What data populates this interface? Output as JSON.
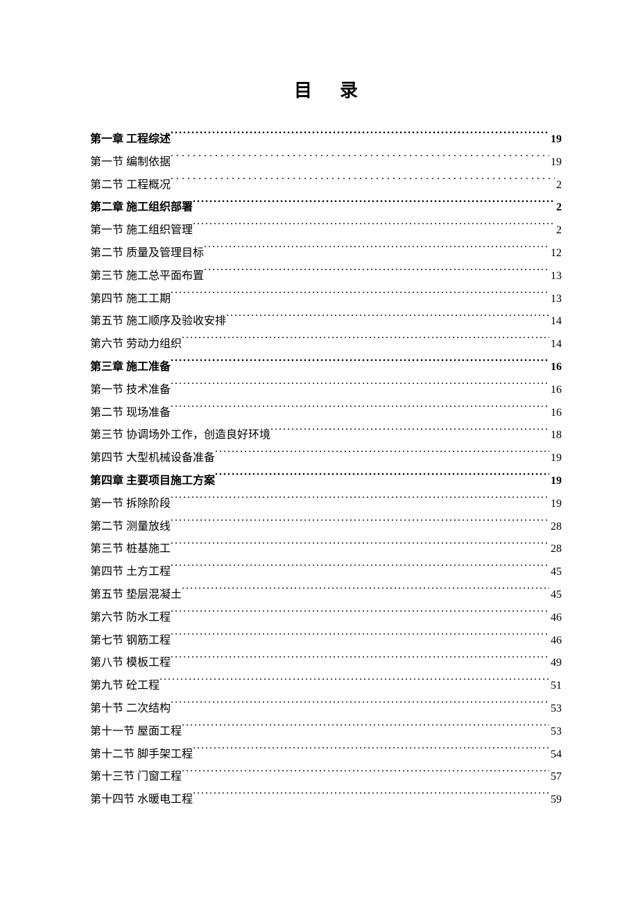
{
  "title": "目录",
  "toc": [
    {
      "label": "第一章 工程综述 ",
      "page": "19",
      "bold": true,
      "leader": "dense"
    },
    {
      "label": "第一节 编制依据 ",
      "page": " 19",
      "bold": false,
      "leader": "sparse"
    },
    {
      "label": "第二节 工程概况 ",
      "page": " 2",
      "bold": false,
      "leader": "sparse"
    },
    {
      "label": "第二章 施工组织部署 ",
      "page": "2",
      "bold": true,
      "leader": "dense"
    },
    {
      "label": "第一节 施工组织管理",
      "page": "2",
      "bold": false,
      "leader": "dense"
    },
    {
      "label": "第二节 质量及管理目标",
      "page": "12",
      "bold": false,
      "leader": "dense"
    },
    {
      "label": "第三节 施工总平面布置",
      "page": "13",
      "bold": false,
      "leader": "dense"
    },
    {
      "label": "第四节 施工工期",
      "page": "13",
      "bold": false,
      "leader": "dense"
    },
    {
      "label": "第五节 施工顺序及验收安排",
      "page": "14",
      "bold": false,
      "leader": "dense"
    },
    {
      "label": "第六节 劳动力组织",
      "page": "14",
      "bold": false,
      "leader": "dense"
    },
    {
      "label": "第三章 施工准备 ",
      "page": "16",
      "bold": true,
      "leader": "dense"
    },
    {
      "label": "第一节 技术准备",
      "page": "16",
      "bold": false,
      "leader": "dense"
    },
    {
      "label": "第二节 现场准备",
      "page": "16",
      "bold": false,
      "leader": "dense"
    },
    {
      "label": "第三节 协调场外工作，创造良好环境",
      "page": "18",
      "bold": false,
      "leader": "dense"
    },
    {
      "label": "第四节 大型机械设备准备",
      "page": "19",
      "bold": false,
      "leader": "dense"
    },
    {
      "label": "第四章 主要项目施工方案 ",
      "page": "19",
      "bold": true,
      "leader": "dense"
    },
    {
      "label": "第一节 拆除阶段",
      "page": "19",
      "bold": false,
      "leader": "dense"
    },
    {
      "label": "第二节 测量放线",
      "page": "28",
      "bold": false,
      "leader": "dense"
    },
    {
      "label": "第三节 桩基施工",
      "page": "28",
      "bold": false,
      "leader": "dense"
    },
    {
      "label": "第四节 土方工程",
      "page": "45",
      "bold": false,
      "leader": "dense"
    },
    {
      "label": "第五节 垫层混凝土",
      "page": "45",
      "bold": false,
      "leader": "dense"
    },
    {
      "label": "第六节 防水工程",
      "page": "46",
      "bold": false,
      "leader": "dense"
    },
    {
      "label": "第七节 钢筋工程",
      "page": "46",
      "bold": false,
      "leader": "dense"
    },
    {
      "label": "第八节 模板工程",
      "page": "49",
      "bold": false,
      "leader": "dense"
    },
    {
      "label": "第九节 砼工程",
      "page": "51",
      "bold": false,
      "leader": "dense"
    },
    {
      "label": "第十节 二次结构",
      "page": "53",
      "bold": false,
      "leader": "dense"
    },
    {
      "label": "第十一节 屋面工程",
      "page": "53",
      "bold": false,
      "leader": "dense"
    },
    {
      "label": "第十二节 脚手架工程",
      "page": "54",
      "bold": false,
      "leader": "dense"
    },
    {
      "label": "第十三节 门窗工程",
      "page": "57",
      "bold": false,
      "leader": "dense"
    },
    {
      "label": "第十四节 水暖电工程",
      "page": "59",
      "bold": false,
      "leader": "dense"
    }
  ]
}
